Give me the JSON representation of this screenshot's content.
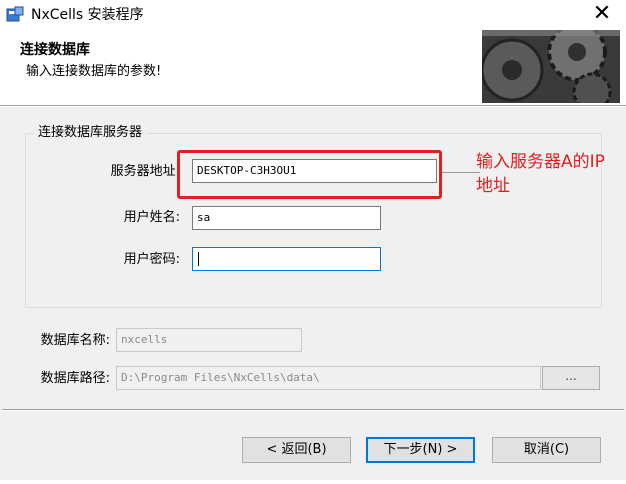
{
  "window": {
    "title": "NxCells 安装程序",
    "close_glyph": "✕"
  },
  "header": {
    "title": "连接数据库",
    "subtitle": "输入连接数据库的参数!"
  },
  "server_group": {
    "legend": "连接数据库服务器",
    "server_address_label": "服务器地址:",
    "server_address_value": "DESKTOP-C3H3OU1",
    "username_label": "用户姓名:",
    "username_value": "sa",
    "password_label": "用户密码:",
    "password_value": ""
  },
  "annotation": {
    "text": "输入服务器A的IP地址",
    "color": "#e02020"
  },
  "database": {
    "name_label": "数据库名称:",
    "name_value": "nxcells",
    "path_label": "数据库路径:",
    "path_value": "D:\\Program Files\\NxCells\\data\\",
    "browse_label": "..."
  },
  "footer": {
    "back_label": "< 返回(B)",
    "next_label": "下一步(N) >",
    "cancel_label": "取消(C)"
  },
  "colors": {
    "accent": "#0078d7",
    "dialog_bg": "#f0f0f0"
  }
}
